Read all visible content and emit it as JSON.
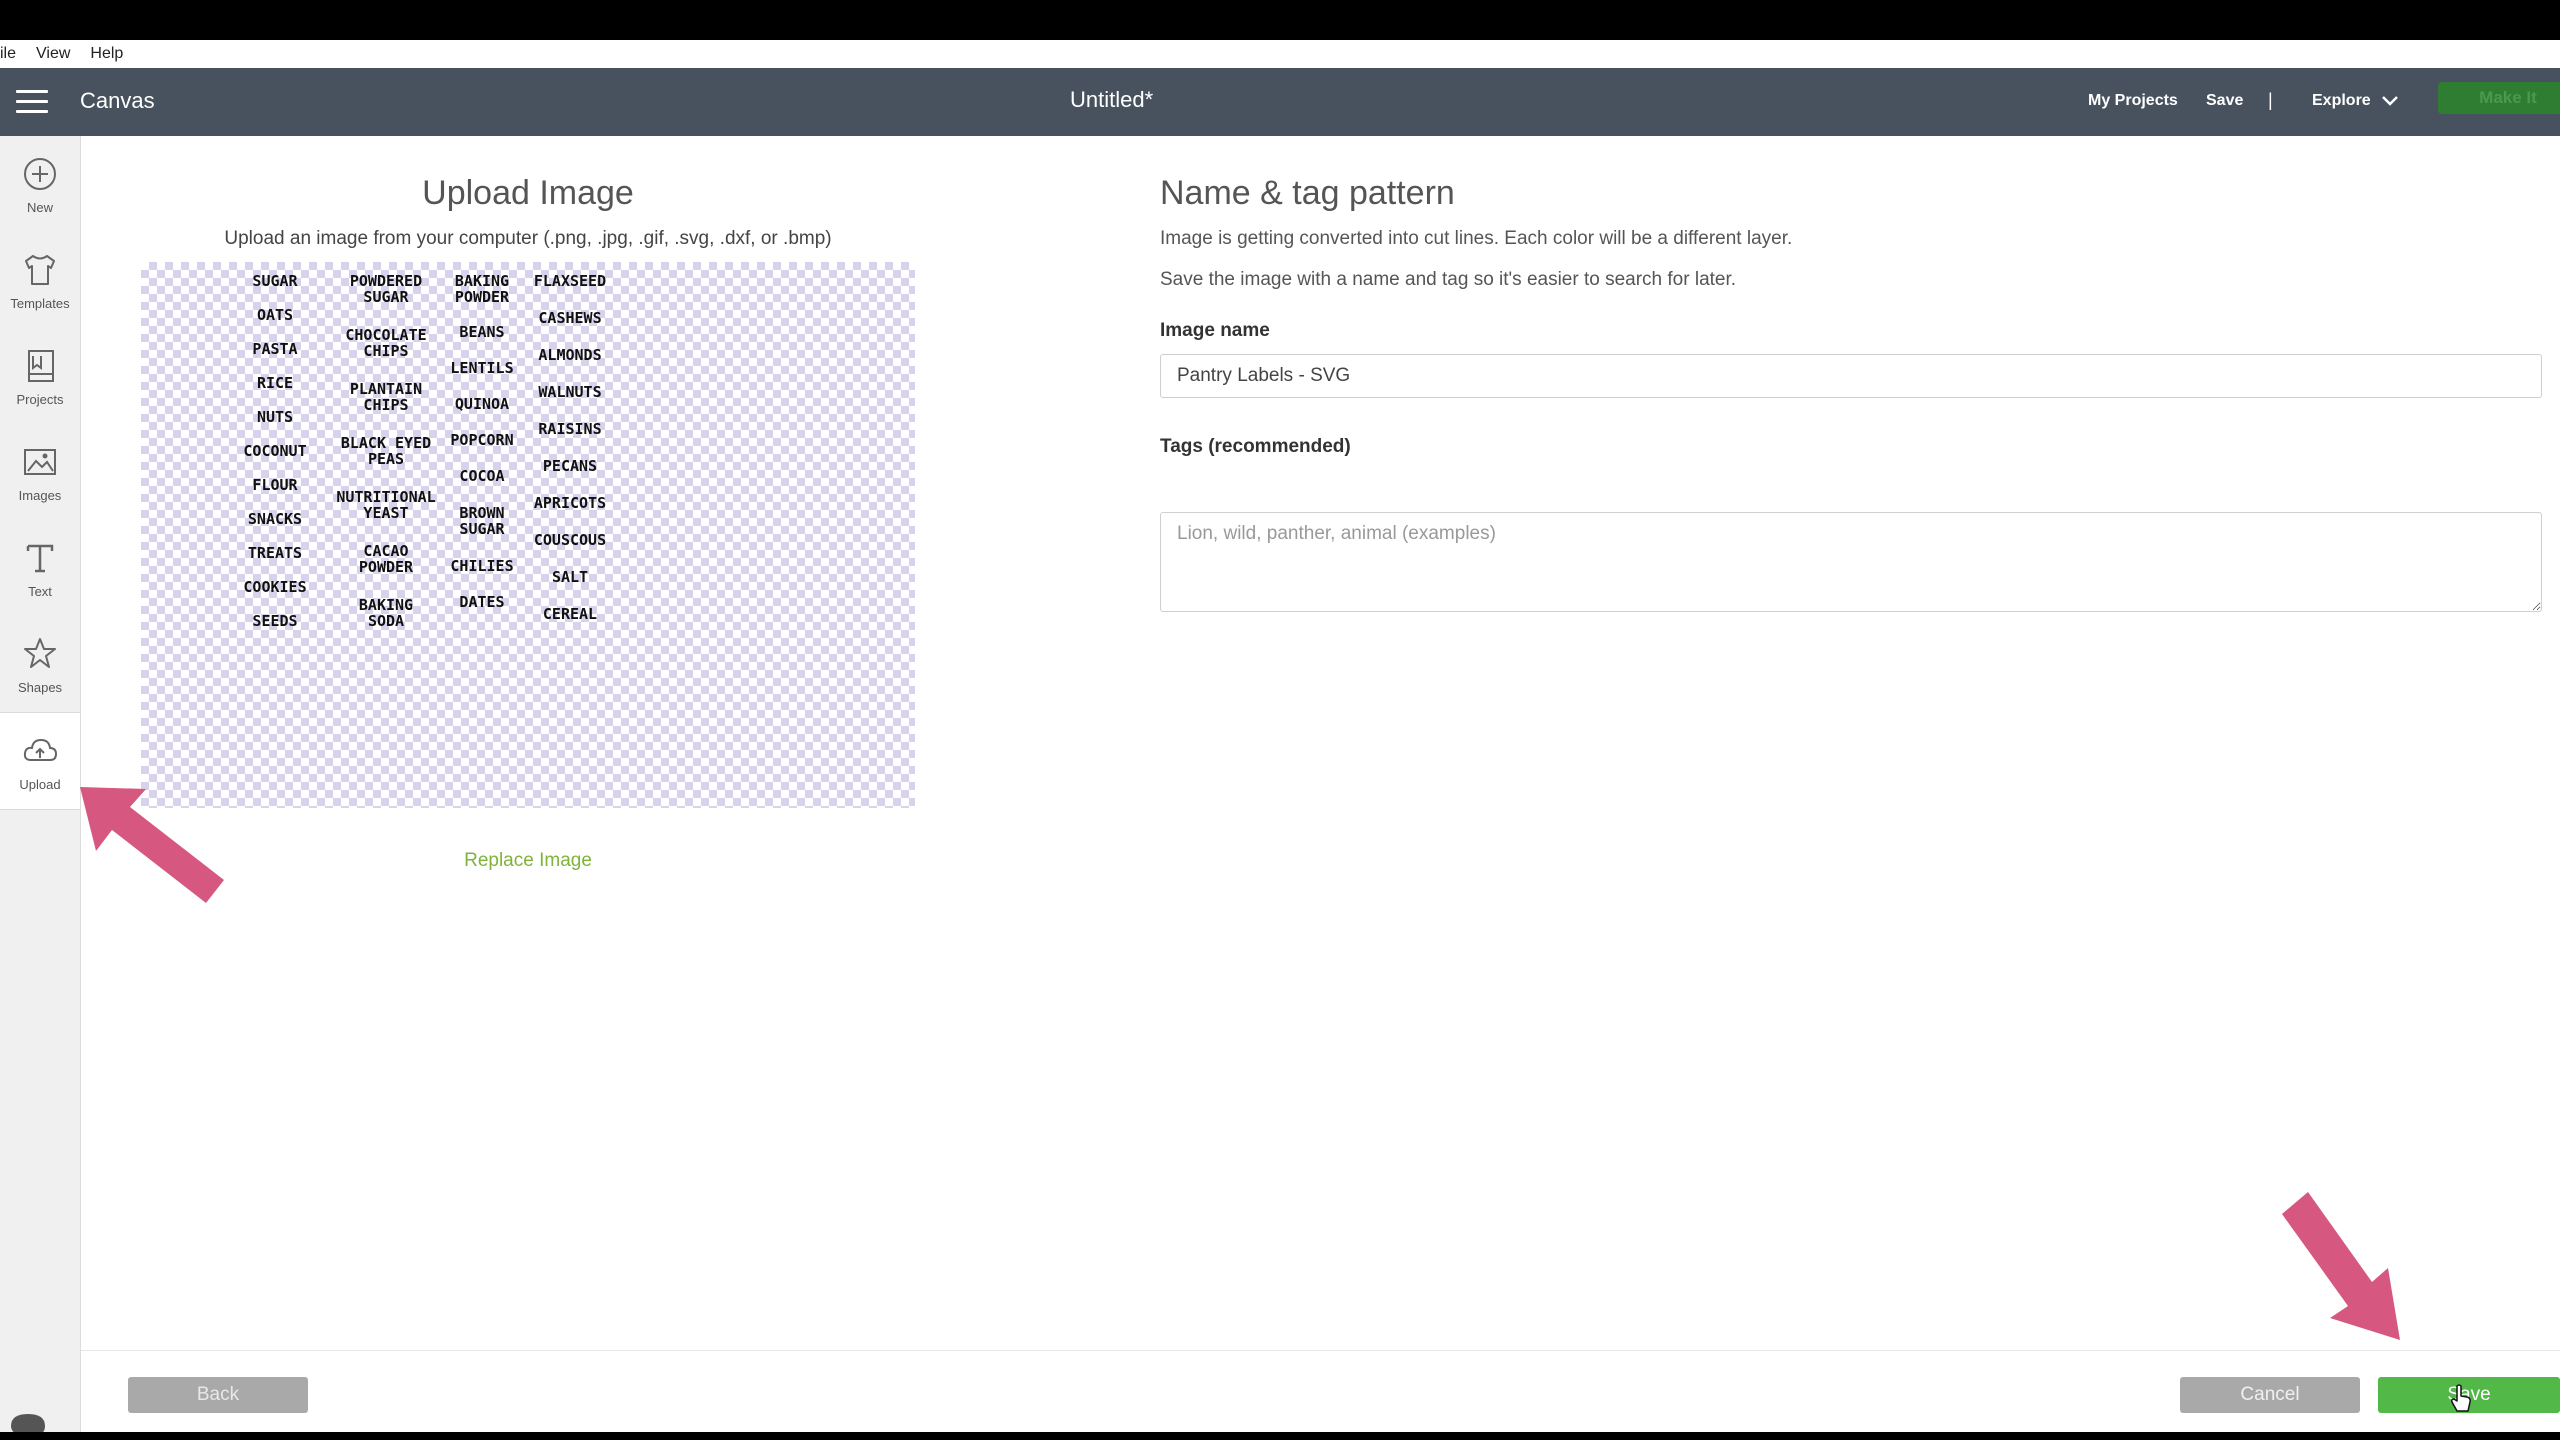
{
  "menubar": {
    "items": [
      "ile",
      "View",
      "Help"
    ]
  },
  "header": {
    "app_name": "Canvas",
    "doc_title": "Untitled*",
    "my_projects": "My Projects",
    "save": "Save",
    "separator": "|",
    "explore": "Explore",
    "make_it": "Make It"
  },
  "sidebar": {
    "items": [
      {
        "label": "New",
        "icon": "plus-circle-icon"
      },
      {
        "label": "Templates",
        "icon": "shirt-icon"
      },
      {
        "label": "Projects",
        "icon": "projects-icon"
      },
      {
        "label": "Images",
        "icon": "image-icon"
      },
      {
        "label": "Text",
        "icon": "text-icon"
      },
      {
        "label": "Shapes",
        "icon": "shapes-icon"
      },
      {
        "label": "Upload",
        "icon": "cloud-upload-icon"
      }
    ]
  },
  "upload": {
    "title": "Upload Image",
    "subtitle": "Upload an image from your computer (.png, .jpg, .gif, .svg, .dxf, or .bmp)",
    "replace": "Replace Image",
    "labels": [
      [
        "SUGAR",
        "OATS",
        "PASTA",
        "RICE",
        "NUTS",
        "COCONUT",
        "FLOUR",
        "SNACKS",
        "TREATS",
        "COOKIES",
        "SEEDS"
      ],
      [
        "POWDERED\nSUGAR",
        "CHOCOLATE\nCHIPS",
        "PLANTAIN\nCHIPS",
        "BLACK EYED\nPEAS",
        "NUTRITIONAL\nYEAST",
        "CACAO\nPOWDER",
        "BAKING\nSODA"
      ],
      [
        "BAKING\nPOWDER",
        "BEANS",
        "LENTILS",
        "QUINOA",
        "POPCORN",
        "COCOA",
        "BROWN\nSUGAR",
        "CHILIES",
        "DATES"
      ],
      [
        "FLAXSEED",
        "CASHEWS",
        "ALMONDS",
        "WALNUTS",
        "RAISINS",
        "PECANS",
        "APRICOTS",
        "COUSCOUS",
        "SALT",
        "CEREAL"
      ]
    ]
  },
  "form": {
    "title": "Name & tag pattern",
    "info1": "Image is getting converted into cut lines. Each color will be a different layer.",
    "info2": "Save the image with a name and tag so it's easier to search for later.",
    "name_label": "Image name",
    "name_value": "Pantry Labels - SVG",
    "tags_label": "Tags (recommended)",
    "tags_placeholder": "Lion, wild, panther, animal (examples)"
  },
  "footer": {
    "back": "Back",
    "cancel": "Cancel",
    "save": "Save"
  },
  "colors": {
    "header_bg": "#48525e",
    "accent_green": "#52b848",
    "link_green": "#7fb339",
    "arrow_pink": "#d6577f"
  }
}
